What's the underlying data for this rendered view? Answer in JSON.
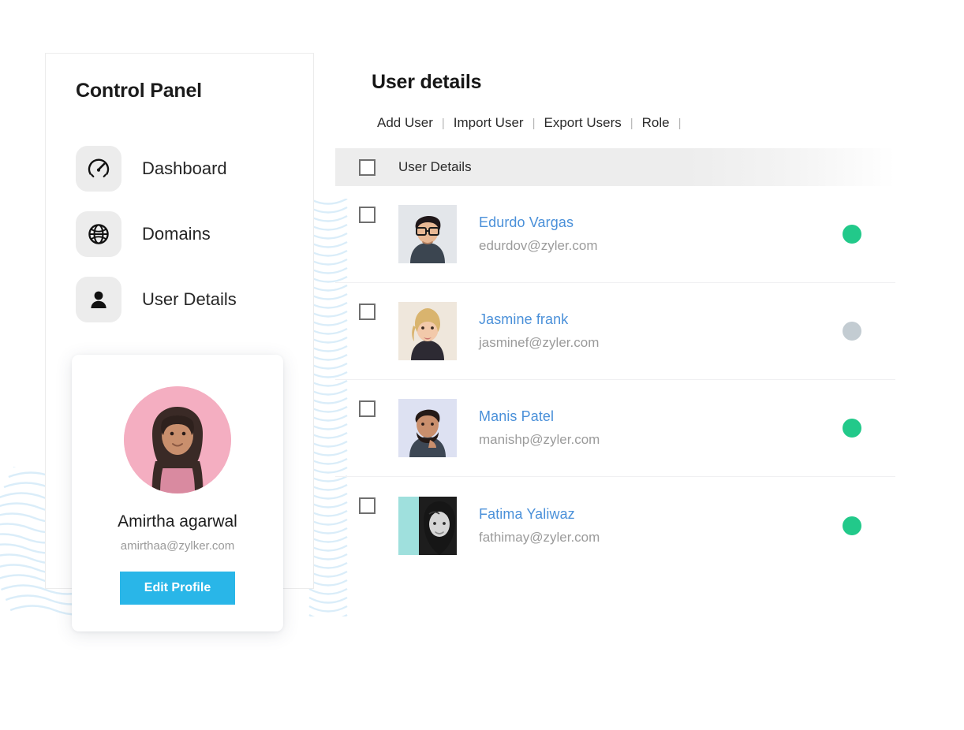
{
  "sidebar": {
    "title": "Control Panel",
    "items": [
      {
        "label": "Dashboard",
        "icon": "speedometer-icon"
      },
      {
        "label": "Domains",
        "icon": "globe-icon"
      },
      {
        "label": "User Details",
        "icon": "person-icon"
      }
    ],
    "profile": {
      "name": "Amirtha agarwal",
      "email": "amirthaa@zylker.com",
      "button_label": "Edit Profile",
      "avatar_bg": "#f4aec1",
      "button_color": "#29b6e8"
    }
  },
  "main": {
    "title": "User details",
    "toolbar": {
      "links": [
        "Add User",
        "Import User",
        "Export Users",
        "Role"
      ],
      "separator": "|"
    },
    "table": {
      "header": {
        "select_all": "",
        "column_label": "User Details"
      },
      "rows": [
        {
          "name": "Edurdo Vargas",
          "email": "edurdov@zyler.com",
          "status": "online",
          "status_color": "#22c98a",
          "avatar_bg": "#e3e6ea"
        },
        {
          "name": "Jasmine frank",
          "email": "jasminef@zyler.com",
          "status": "offline",
          "status_color": "#c3ccd2",
          "avatar_bg": "#efe7dc"
        },
        {
          "name": "Manis Patel",
          "email": "manishp@zyler.com",
          "status": "online",
          "status_color": "#22c98a",
          "avatar_bg": "#dde1f2"
        },
        {
          "name": "Fatima Yaliwaz",
          "email": "fathimay@zyler.com",
          "status": "online",
          "status_color": "#22c98a",
          "avatar_bg": "#9fe0dd"
        }
      ]
    }
  },
  "theme": {
    "link_blue": "#4a90d9",
    "muted_gray": "#9b9b9b",
    "header_gray": "#ededed",
    "wave_blue": "#bcdff5"
  }
}
